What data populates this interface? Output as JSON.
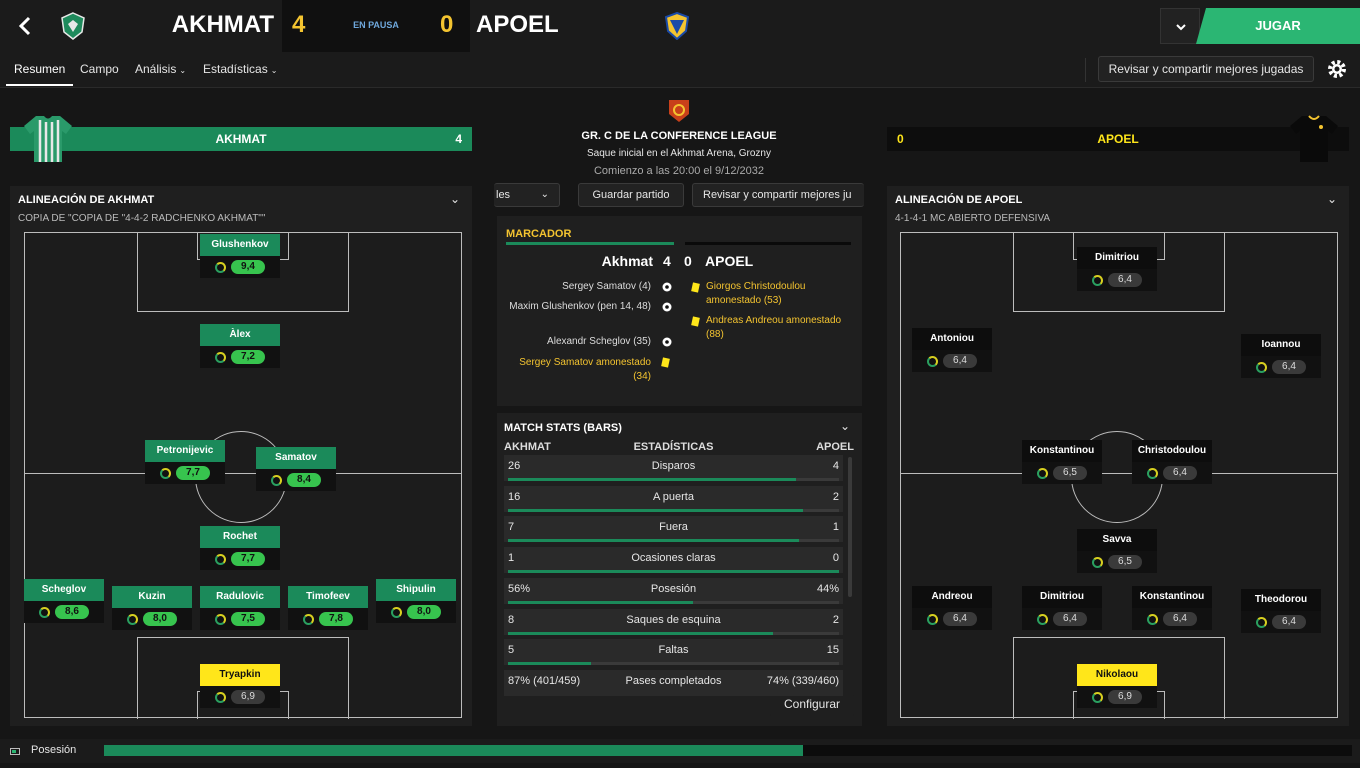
{
  "header": {
    "home_team": "AKHMAT",
    "home_score": "4",
    "status": "EN PAUSA",
    "away_score": "0",
    "away_team": "APOEL",
    "play_button": "JUGAR"
  },
  "nav": {
    "tabs": [
      "Resumen",
      "Campo",
      "Análisis",
      "Estadísticas"
    ],
    "share_button": "Revisar y compartir mejores jugadas"
  },
  "match_info": {
    "competition": "GR. C DE LA CONFERENCE LEAGUE",
    "venue": "Saque inicial en el Akhmat Arena, Grozny",
    "kickoff": "Comienzo a las 20:00 el 9/12/2032",
    "toolbar_partial": "les",
    "save_button": "Guardar partido",
    "share_button_partial": "Revisar y compartir mejores ju"
  },
  "home_banner": {
    "name": "AKHMAT",
    "score": "4"
  },
  "away_banner": {
    "name": "APOEL",
    "score": "0"
  },
  "home_lineup": {
    "title": "ALINEACIÓN DE AKHMAT",
    "subtitle": "COPIA DE \"COPIA DE \"4-4-2 RADCHENKO AKHMAT\"\"",
    "players": [
      {
        "name": "Glushenkov",
        "rating": "9,4",
        "style": "green"
      },
      {
        "name": "Àlex",
        "rating": "7,2",
        "style": "green"
      },
      {
        "name": "Petronijevic",
        "rating": "7,7",
        "style": "green"
      },
      {
        "name": "Samatov",
        "rating": "8,4",
        "style": "green"
      },
      {
        "name": "Rochet",
        "rating": "7,7",
        "style": "green"
      },
      {
        "name": "Scheglov",
        "rating": "8,6",
        "style": "green"
      },
      {
        "name": "Kuzin",
        "rating": "8,0",
        "style": "green"
      },
      {
        "name": "Radulovic",
        "rating": "7,5",
        "style": "green"
      },
      {
        "name": "Timofeev",
        "rating": "7,8",
        "style": "green"
      },
      {
        "name": "Shipulin",
        "rating": "8,0",
        "style": "green"
      },
      {
        "name": "Tryapkin",
        "rating": "6,9",
        "style": "yellow"
      }
    ]
  },
  "away_lineup": {
    "title": "ALINEACIÓN DE APOEL",
    "subtitle": "4-1-4-1 MC ABIERTO DEFENSIVA",
    "players": [
      {
        "name": "Dimitriou",
        "rating": "6,4",
        "style": "black"
      },
      {
        "name": "Antoniou",
        "rating": "6,4",
        "style": "black"
      },
      {
        "name": "Ioannou",
        "rating": "6,4",
        "style": "black"
      },
      {
        "name": "Konstantinou",
        "rating": "6,5",
        "style": "black"
      },
      {
        "name": "Christodoulou",
        "rating": "6,4",
        "style": "black"
      },
      {
        "name": "Savva",
        "rating": "6,5",
        "style": "black"
      },
      {
        "name": "Andreou",
        "rating": "6,4",
        "style": "black"
      },
      {
        "name": "Dimitriou",
        "rating": "6,4",
        "style": "black"
      },
      {
        "name": "Konstantinou",
        "rating": "6,4",
        "style": "black"
      },
      {
        "name": "Theodorou",
        "rating": "6,4",
        "style": "black"
      },
      {
        "name": "Nikolaou",
        "rating": "6,9",
        "style": "yellow"
      }
    ]
  },
  "scoreboard": {
    "title": "MARCADOR",
    "home": "Akhmat",
    "home_score": "4",
    "away_score": "0",
    "away": "APOEL",
    "home_events": [
      {
        "text": "Sergey Samatov (4)",
        "type": "goal"
      },
      {
        "text": "Maxim Glushenkov (pen 14, 48)",
        "type": "goal"
      },
      {
        "text": "Alexandr Scheglov (35)",
        "type": "goal"
      },
      {
        "text": "Sergey Samatov amonestado (34)",
        "type": "card"
      }
    ],
    "away_events": [
      {
        "text": "Giorgos Christodoulou amonestado (53)",
        "type": "card"
      },
      {
        "text": "Andreas Andreou amonestado (88)",
        "type": "card"
      }
    ]
  },
  "stats": {
    "title": "MATCH STATS (BARS)",
    "col_home": "AKHMAT",
    "col_mid": "ESTADÍSTICAS",
    "col_away": "APOEL",
    "rows": [
      {
        "home": "26",
        "label": "Disparos",
        "away": "4",
        "home_share": 0.87
      },
      {
        "home": "16",
        "label": "A puerta",
        "away": "2",
        "home_share": 0.89
      },
      {
        "home": "7",
        "label": "Fuera",
        "away": "1",
        "home_share": 0.88
      },
      {
        "home": "1",
        "label": "Ocasiones claras",
        "away": "0",
        "home_share": 1.0
      },
      {
        "home": "56%",
        "label": "Posesión",
        "away": "44%",
        "home_share": 0.56
      },
      {
        "home": "8",
        "label": "Saques de esquina",
        "away": "2",
        "home_share": 0.8
      },
      {
        "home": "5",
        "label": "Faltas",
        "away": "15",
        "home_share": 0.25
      },
      {
        "home": "87% (401/459)",
        "label": "Pases completados",
        "away": "74% (339/460)",
        "home_share": null
      }
    ],
    "configure_button": "Configurar"
  },
  "possession_bar": {
    "label": "Posesión",
    "home_share": 0.56
  },
  "colors": {
    "accent_green": "#1b8a5a",
    "play_green": "#2bb673",
    "yellow": "#ffe61a",
    "score_yellow": "#f4c430"
  },
  "icons": [
    "back-arrow-icon",
    "akhmat-crest-icon",
    "apoel-crest-icon",
    "gear-icon",
    "chevron-down-icon",
    "competition-logo-icon",
    "ball-icon",
    "yellow-card-icon",
    "rating-icon",
    "possession-icon"
  ]
}
